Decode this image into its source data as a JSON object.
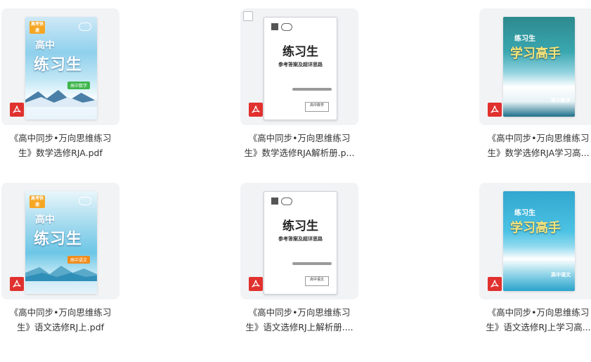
{
  "files": [
    {
      "line1": "《高中同步•万向思维练习",
      "line2": "生》数学选修RJA.pdf",
      "cover_type": "bookA",
      "cover_small": "高中",
      "cover_big": "练习生",
      "cover_tag": "高中数学",
      "cover_badge": "高考快递"
    },
    {
      "line1": "《高中同步•万向思维练习",
      "line2": "生》数学选修RJA解析册.p...",
      "cover_type": "answer",
      "cover_title": "练习生",
      "cover_sub": "参考答案及超详思路",
      "cover_box": "高中数学"
    },
    {
      "line1": "《高中同步•万向思维练习",
      "line2": "生》数学选修RJA学习高...",
      "cover_type": "high",
      "cover_title1": "练习生",
      "cover_title2": "学习高手",
      "cover_subject": "高中数学"
    },
    {
      "line1": "《高中同步•万向思维练习",
      "line2": "生》语文选修RJ上.pdf",
      "cover_type": "bookB",
      "cover_small": "高中",
      "cover_big": "练习生",
      "cover_tag": "高中语文",
      "cover_badge": "高考快递"
    },
    {
      "line1": "《高中同步•万向思维练习",
      "line2": "生》语文选修RJ上解析册....",
      "cover_type": "answer",
      "cover_title": "练习生",
      "cover_sub": "参考答案及超详思路",
      "cover_box": "高中语文"
    },
    {
      "line1": "《高中同步•万向思维练习",
      "line2": "生》语文选修RJ上学习高...",
      "cover_type": "highB",
      "cover_title1": "练习生",
      "cover_title2": "学习高手",
      "cover_subject": "高中语文"
    }
  ],
  "icons": {
    "file_type": "pdf-icon"
  },
  "colors": {
    "pdf_red": "#e0312f",
    "tile_bg": "#f2f3f5",
    "text": "#333333"
  }
}
